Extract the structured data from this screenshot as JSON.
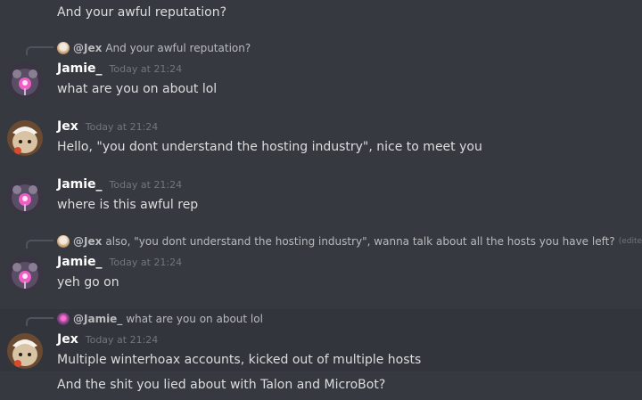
{
  "messages": {
    "m0": {
      "text": "And your awful reputation?"
    },
    "m1": {
      "reply": {
        "user": "@Jex",
        "text": "And your awful reputation?"
      },
      "author": "Jamie_",
      "timestamp": "Today at 21:24",
      "text": "what are you on about lol"
    },
    "m2": {
      "author": "Jex",
      "timestamp": "Today at 21:24",
      "text": "Hello, \"you dont understand the hosting industry\", nice to meet you"
    },
    "m3": {
      "author": "Jamie_",
      "timestamp": "Today at 21:24",
      "text": "where is this awful rep"
    },
    "m4": {
      "reply": {
        "user": "@Jex",
        "text": "also, \"you dont understand the hosting industry\", wanna talk about all the hosts you have left?",
        "edited": "(edited)"
      },
      "author": "Jamie_",
      "timestamp": "Today at 21:24",
      "text": "yeh go on"
    },
    "m5": {
      "reply": {
        "user": "@Jamie_",
        "text": "what are you on about lol"
      },
      "author": "Jex",
      "timestamp": "Today at 21:24",
      "text": "Multiple winterhoax accounts, kicked out of multiple hosts"
    },
    "m6": {
      "text": "And the shit you lied about with Talon and MicroBot?"
    }
  },
  "colors": {
    "background": "#36393f",
    "highlight": "#32353b",
    "username": "#ffffff",
    "timestamp": "#72767d",
    "body_text": "#dcddde"
  }
}
